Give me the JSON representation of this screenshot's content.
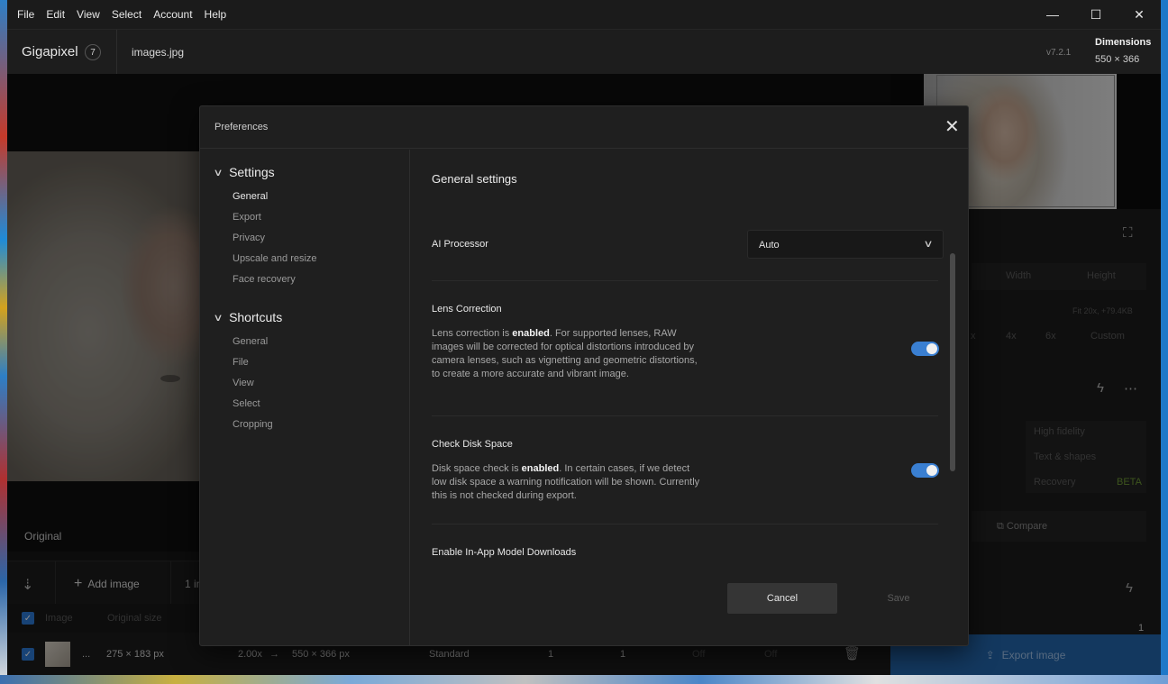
{
  "menu": [
    "File",
    "Edit",
    "View",
    "Select",
    "Account",
    "Help"
  ],
  "window_controls": {
    "minimize": "—",
    "maximize": "☐",
    "close": "✕"
  },
  "header": {
    "app_name": "Gigapixel",
    "badge": "7",
    "filename": "images.jpg",
    "version": "v7.2.1",
    "dimensions_label": "Dimensions",
    "dimensions_value": "550 × 366"
  },
  "canvas": {
    "original_label": "Original"
  },
  "queue": {
    "add_label": "Add image",
    "count_text": "1 in",
    "headers": {
      "image": "Image",
      "original_size": "Original size"
    },
    "row": {
      "ellipsis": "...",
      "original_size": "275 × 183 px",
      "scale": "2.00x",
      "arrow": "→",
      "output_size": "550 × 366 px",
      "model": "Standard",
      "v1": "1",
      "v2": "1",
      "v3": "Off",
      "v4": "Off"
    }
  },
  "right_panel": {
    "width_label": "Width",
    "height_label": "Height",
    "fit_text": "Fit 20x, +79.4KB",
    "scale_options": [
      "x",
      "4x",
      "6x",
      "Custom"
    ],
    "model_options": [
      "High fidelity",
      "Text & shapes",
      "Recovery"
    ],
    "beta": "BETA",
    "compare": "Compare",
    "count": "1",
    "export": "Export image"
  },
  "dialog": {
    "title": "Preferences",
    "close": "✕",
    "nav": {
      "settings_label": "Settings",
      "settings_items": [
        "General",
        "Export",
        "Privacy",
        "Upscale and resize",
        "Face recovery"
      ],
      "shortcuts_label": "Shortcuts",
      "shortcuts_items": [
        "General",
        "File",
        "View",
        "Select",
        "Cropping"
      ]
    },
    "section_title": "General settings",
    "ai_processor": {
      "label": "AI Processor",
      "value": "Auto"
    },
    "lens": {
      "label": "Lens Correction",
      "pre": "Lens correction is ",
      "state": "enabled",
      "post": ". For supported lenses, RAW images will be corrected for optical distortions introduced by camera lenses, such as vignetting and geometric distortions, to create a more accurate and vibrant image.",
      "enabled": true
    },
    "disk": {
      "label": "Check Disk Space",
      "pre": "Disk space check is ",
      "state": "enabled",
      "post": ". In certain cases, if we detect low disk space a warning notification will be shown. Currently this is not checked during export.",
      "enabled": true
    },
    "downloads": {
      "label": "Enable In-App Model Downloads"
    },
    "cancel": "Cancel",
    "save": "Save"
  },
  "colors": {
    "accent": "#3a7fd1",
    "export_bg": "#2466ad",
    "beta": "#8cc63f"
  }
}
